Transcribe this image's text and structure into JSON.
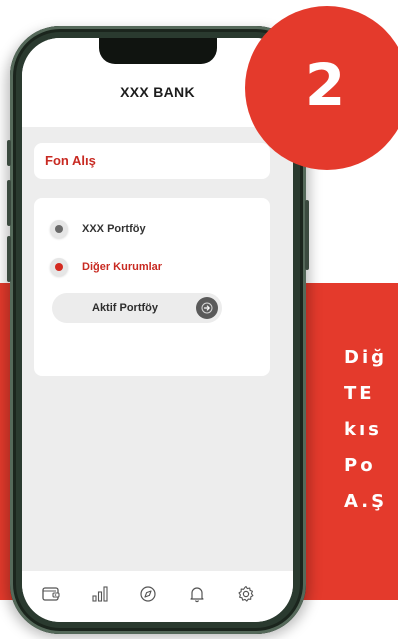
{
  "step": {
    "number": "2"
  },
  "app": {
    "title": "XXX BANK"
  },
  "fon_card": {
    "label": "Fon Alış"
  },
  "options": {
    "xxx": {
      "label": "XXX Portföy",
      "selected": false
    },
    "diger": {
      "label": "Diğer Kurumlar",
      "selected": true
    }
  },
  "portfolio_button": {
    "label": "Aktif Portföy"
  },
  "tabbar": {
    "items": [
      {
        "icon": "wallet-icon"
      },
      {
        "icon": "bar-chart-icon"
      },
      {
        "icon": "compass-icon"
      },
      {
        "icon": "bell-icon"
      },
      {
        "icon": "gear-icon"
      }
    ]
  },
  "promo": {
    "lines": [
      "Diğ",
      "TE",
      "kıs",
      "Po",
      "A.Ş"
    ]
  },
  "colors": {
    "accent_red": "#e43a2c",
    "label_red": "#c82a22",
    "phone_frame": "#2a3a2f",
    "screen_bg": "#ededed"
  }
}
